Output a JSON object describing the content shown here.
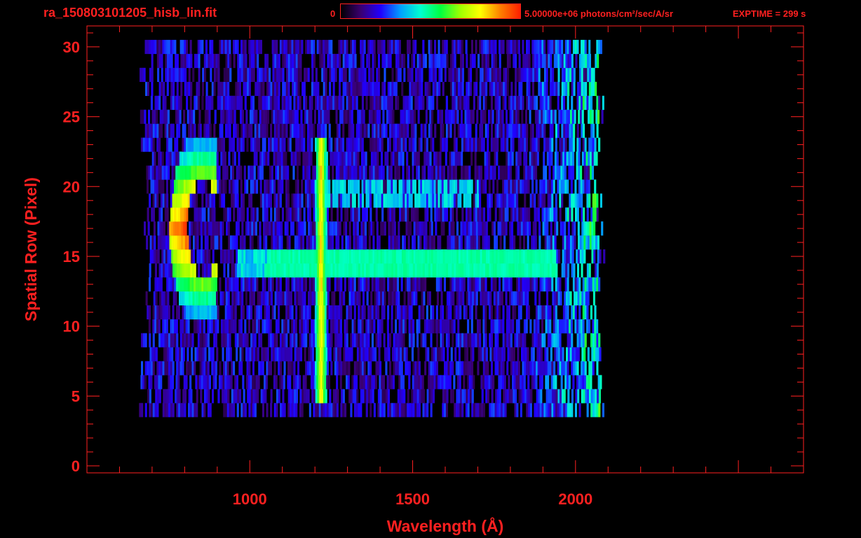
{
  "header": {
    "file_title": "ra_150803101205_hisb_lin.fit",
    "colorbar_min": "0",
    "colorbar_max_label": "5.00000e+06 photons/cm²/sec/A/sr",
    "exptime_label": "EXPTIME = 299 s"
  },
  "colors": {
    "axis": "#ff2020",
    "background": "#000000",
    "colormap": [
      "#000000",
      "#3a0070",
      "#2000ff",
      "#00a0ff",
      "#00ffd0",
      "#00ff40",
      "#a0ff00",
      "#ffff00",
      "#ff8000",
      "#ff2000"
    ]
  },
  "chart_data": {
    "type": "heatmap",
    "title": "ra_150803101205_hisb_lin.fit",
    "xlabel": "Wavelength (Å)",
    "ylabel": "Spatial Row (Pixel)",
    "xlim": [
      500,
      2700
    ],
    "ylim": [
      -0.5,
      31.5
    ],
    "xticks": [
      1000,
      1500,
      2000
    ],
    "yticks": [
      0,
      5,
      10,
      15,
      20,
      25,
      30
    ],
    "colorbar": {
      "min": 0,
      "max": 5000000,
      "units": "photons/cm²/sec/A/sr"
    },
    "grid": false,
    "detector_extent": {
      "rows": [
        4,
        30
      ],
      "wavelength": [
        680,
        2090
      ]
    },
    "features": [
      {
        "name": "Lyman-alpha line",
        "wavelength": 1216,
        "rows": [
          5,
          23
        ],
        "peak_value": 0.86
      },
      {
        "name": "C-shaped emission",
        "wavelength_range": [
          760,
          910
        ],
        "rows": [
          11,
          23
        ],
        "peak_value": 0.95
      },
      {
        "name": "continuum",
        "row": 14.5,
        "wavelength_range": [
          1050,
          1920
        ],
        "value": 0.5
      }
    ]
  }
}
